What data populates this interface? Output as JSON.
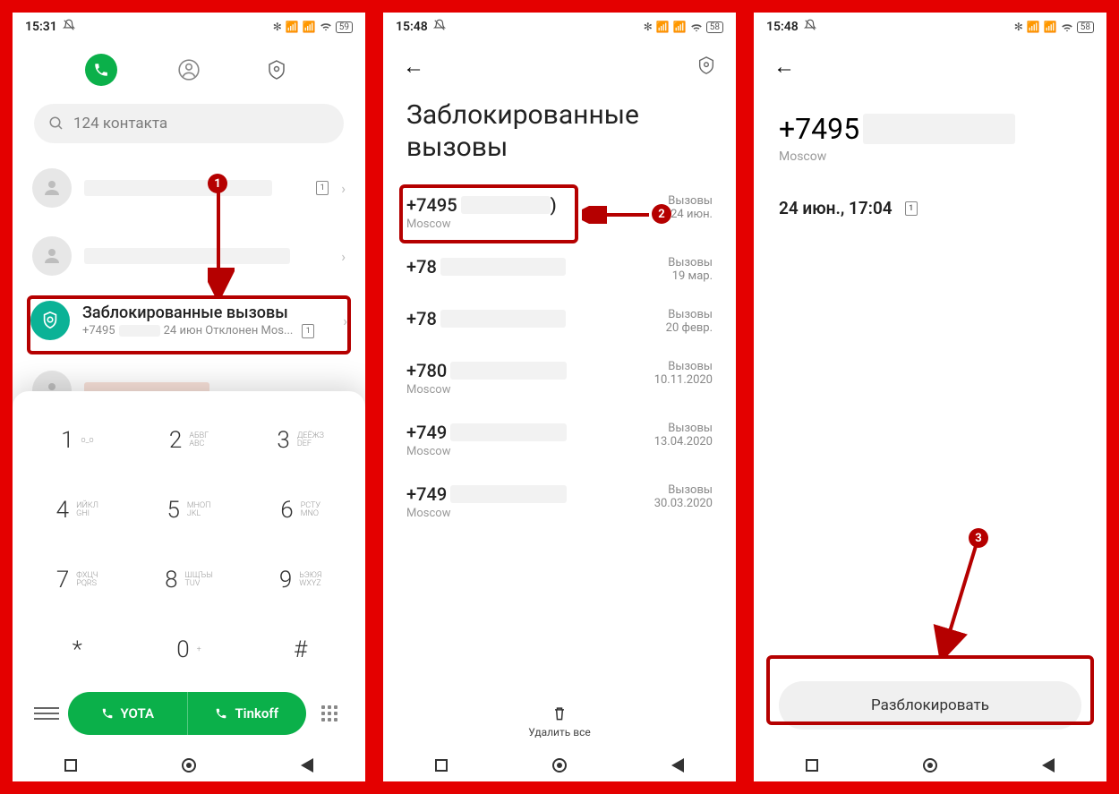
{
  "screen1": {
    "status": {
      "time": "15:31",
      "battery": "59"
    },
    "search_placeholder": "124 контакта",
    "blocked_card": {
      "title": "Заблокированные вызовы",
      "sub_prefix": "+7495",
      "sub_suffix": "24 июн Отклонен  Mos..."
    },
    "keypad": [
      {
        "digit": "1",
        "letters_top": "о_о",
        "letters_bot": ""
      },
      {
        "digit": "2",
        "letters_top": "АБВГ",
        "letters_bot": "ABC"
      },
      {
        "digit": "3",
        "letters_top": "ДЕЁЖЗ",
        "letters_bot": "DEF"
      },
      {
        "digit": "4",
        "letters_top": "ИЙКЛ",
        "letters_bot": "GHI"
      },
      {
        "digit": "5",
        "letters_top": "МНОП",
        "letters_bot": "JKL"
      },
      {
        "digit": "6",
        "letters_top": "РСТУ",
        "letters_bot": "MNO"
      },
      {
        "digit": "7",
        "letters_top": "ФХЦЧ",
        "letters_bot": "PQRS"
      },
      {
        "digit": "8",
        "letters_top": "ШЩЪЫ",
        "letters_bot": "TUV"
      },
      {
        "digit": "9",
        "letters_top": "ЬЭЮЯ",
        "letters_bot": "WXYZ"
      },
      {
        "digit": "*",
        "letters_top": "",
        "letters_bot": ""
      },
      {
        "digit": "0",
        "letters_top": "+",
        "letters_bot": ""
      },
      {
        "digit": "#",
        "letters_top": "",
        "letters_bot": ""
      }
    ],
    "sim1": "YOTA",
    "sim2": "Tinkoff"
  },
  "screen2": {
    "status": {
      "time": "15:48",
      "battery": "58"
    },
    "title": "Заблокированные вызовы",
    "items": [
      {
        "num": "+7495",
        "suffix": ")",
        "loc": "Moscow",
        "right_top": "Вызовы",
        "right_bot": "24 июн."
      },
      {
        "num": "+78",
        "suffix": "",
        "loc": "",
        "right_top": "Вызовы",
        "right_bot": "19 мар."
      },
      {
        "num": "+78",
        "suffix": "",
        "loc": "",
        "right_top": "Вызовы",
        "right_bot": "20 февр."
      },
      {
        "num": "+780",
        "suffix": "",
        "loc": "Moscow",
        "right_top": "Вызовы",
        "right_bot": "10.11.2020"
      },
      {
        "num": "+749",
        "suffix": "",
        "loc": "Moscow",
        "right_top": "Вызовы",
        "right_bot": "13.04.2020"
      },
      {
        "num": "+749",
        "suffix": "",
        "loc": "Moscow",
        "right_top": "Вызовы",
        "right_bot": "30.03.2020"
      }
    ],
    "delete_all": "Удалить все"
  },
  "screen3": {
    "status": {
      "time": "15:48",
      "battery": "58"
    },
    "number_prefix": "+7495",
    "location": "Moscow",
    "call_time": "24 июн., 17:04",
    "sim_badge": "1",
    "unblock": "Разблокировать"
  },
  "markers": {
    "m1": "1",
    "m2": "2",
    "m3": "3"
  }
}
